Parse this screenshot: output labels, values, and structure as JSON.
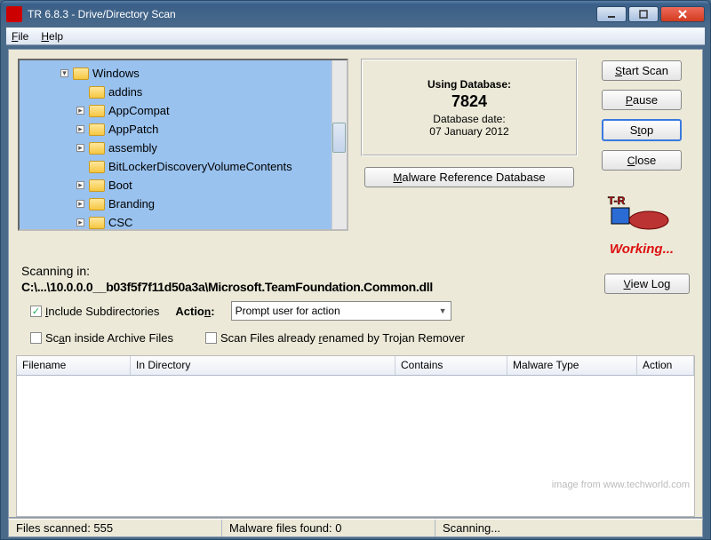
{
  "window": {
    "title": "TR 6.8.3  -  Drive/Directory Scan"
  },
  "menu": {
    "file": "File",
    "help": "Help"
  },
  "tree": {
    "root": "Windows",
    "children": [
      "addins",
      "AppCompat",
      "AppPatch",
      "assembly",
      "BitLockerDiscoveryVolumeContents",
      "Boot",
      "Branding",
      "CSC"
    ],
    "expanders": [
      false,
      true,
      true,
      true,
      false,
      true,
      true,
      true
    ]
  },
  "database": {
    "using_label": "Using Database:",
    "number": "7824",
    "date_label": "Database date:",
    "date_value": "07 January 2012"
  },
  "buttons": {
    "malware_db": "Malware Reference Database",
    "start_scan": "Start Scan",
    "pause": "Pause",
    "stop": "Stop",
    "close": "Close",
    "view_log": "View Log"
  },
  "scan": {
    "label": "Scanning in:",
    "path": "C:\\...\\10.0.0.0__b03f5f7f11d50a3a\\Microsoft.TeamFoundation.Common.dll"
  },
  "options": {
    "include_sub": "Include Subdirectories",
    "scan_archives": "Scan inside Archive Files",
    "scan_renamed": "Scan Files already renamed by Trojan Remover",
    "action_label": "Action:",
    "action_value": "Prompt user for action"
  },
  "columns": {
    "filename": "Filename",
    "in_dir": "In Directory",
    "contains": "Contains",
    "malware_type": "Malware Type",
    "action": "Action"
  },
  "status": {
    "files": "Files scanned: 555",
    "malware": "Malware files found: 0",
    "state": "Scanning..."
  },
  "working_label": "Working...",
  "watermark": "image from www.techworld.com"
}
